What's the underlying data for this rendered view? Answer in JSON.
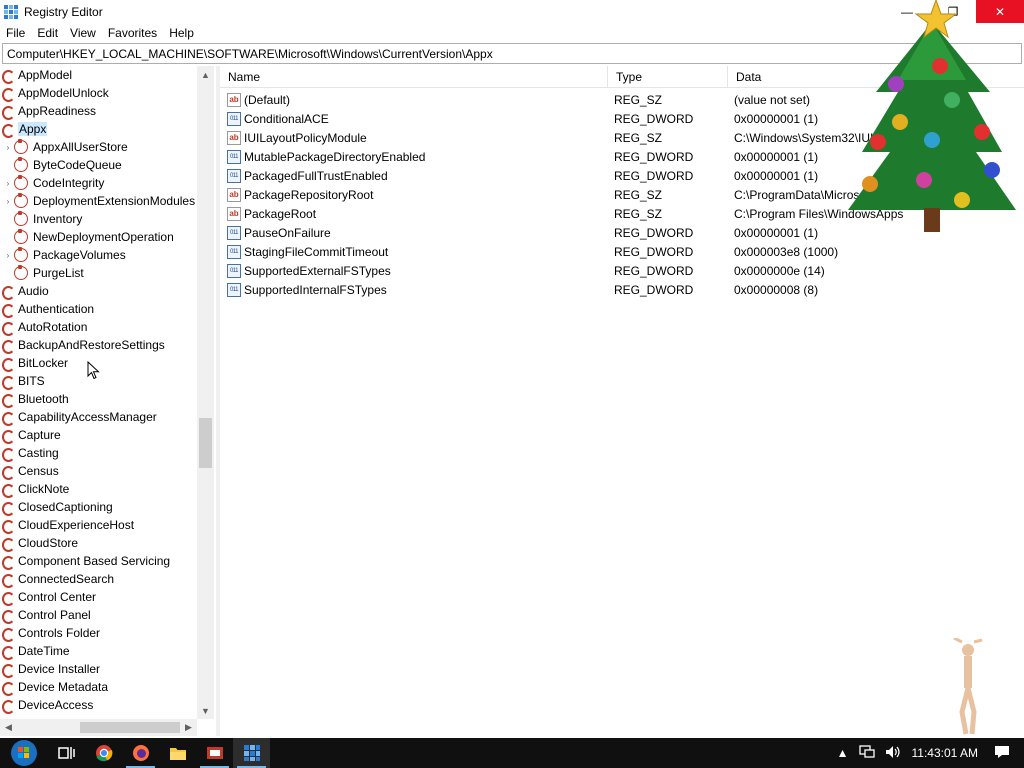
{
  "window": {
    "title": "Registry Editor",
    "controls": {
      "minimize": "—",
      "maximize": "❐",
      "close": "✕"
    }
  },
  "menu": [
    "File",
    "Edit",
    "View",
    "Favorites",
    "Help"
  ],
  "address": "Computer\\HKEY_LOCAL_MACHINE\\SOFTWARE\\Microsoft\\Windows\\CurrentVersion\\Appx",
  "tree": {
    "items": [
      {
        "label": "AppModel",
        "level": 0,
        "expandable": false,
        "selected": false
      },
      {
        "label": "AppModelUnlock",
        "level": 0,
        "expandable": false,
        "selected": false
      },
      {
        "label": "AppReadiness",
        "level": 0,
        "expandable": false,
        "selected": false
      },
      {
        "label": "Appx",
        "level": 0,
        "expandable": false,
        "selected": true
      },
      {
        "label": "AppxAllUserStore",
        "level": 1,
        "expandable": true,
        "selected": false
      },
      {
        "label": "ByteCodeQueue",
        "level": 1,
        "expandable": false,
        "selected": false
      },
      {
        "label": "CodeIntegrity",
        "level": 1,
        "expandable": true,
        "selected": false
      },
      {
        "label": "DeploymentExtensionModules",
        "level": 1,
        "expandable": true,
        "selected": false
      },
      {
        "label": "Inventory",
        "level": 1,
        "expandable": false,
        "selected": false
      },
      {
        "label": "NewDeploymentOperation",
        "level": 1,
        "expandable": false,
        "selected": false
      },
      {
        "label": "PackageVolumes",
        "level": 1,
        "expandable": true,
        "selected": false
      },
      {
        "label": "PurgeList",
        "level": 1,
        "expandable": false,
        "selected": false
      },
      {
        "label": "Audio",
        "level": 0,
        "expandable": false,
        "selected": false
      },
      {
        "label": "Authentication",
        "level": 0,
        "expandable": false,
        "selected": false
      },
      {
        "label": "AutoRotation",
        "level": 0,
        "expandable": false,
        "selected": false
      },
      {
        "label": "BackupAndRestoreSettings",
        "level": 0,
        "expandable": false,
        "selected": false
      },
      {
        "label": "BitLocker",
        "level": 0,
        "expandable": false,
        "selected": false
      },
      {
        "label": "BITS",
        "level": 0,
        "expandable": false,
        "selected": false
      },
      {
        "label": "Bluetooth",
        "level": 0,
        "expandable": false,
        "selected": false
      },
      {
        "label": "CapabilityAccessManager",
        "level": 0,
        "expandable": false,
        "selected": false
      },
      {
        "label": "Capture",
        "level": 0,
        "expandable": false,
        "selected": false
      },
      {
        "label": "Casting",
        "level": 0,
        "expandable": false,
        "selected": false
      },
      {
        "label": "Census",
        "level": 0,
        "expandable": false,
        "selected": false
      },
      {
        "label": "ClickNote",
        "level": 0,
        "expandable": false,
        "selected": false
      },
      {
        "label": "ClosedCaptioning",
        "level": 0,
        "expandable": false,
        "selected": false
      },
      {
        "label": "CloudExperienceHost",
        "level": 0,
        "expandable": false,
        "selected": false
      },
      {
        "label": "CloudStore",
        "level": 0,
        "expandable": false,
        "selected": false
      },
      {
        "label": "Component Based Servicing",
        "level": 0,
        "expandable": false,
        "selected": false
      },
      {
        "label": "ConnectedSearch",
        "level": 0,
        "expandable": false,
        "selected": false
      },
      {
        "label": "Control Center",
        "level": 0,
        "expandable": false,
        "selected": false
      },
      {
        "label": "Control Panel",
        "level": 0,
        "expandable": false,
        "selected": false
      },
      {
        "label": "Controls Folder",
        "level": 0,
        "expandable": false,
        "selected": false
      },
      {
        "label": "DateTime",
        "level": 0,
        "expandable": false,
        "selected": false
      },
      {
        "label": "Device Installer",
        "level": 0,
        "expandable": false,
        "selected": false
      },
      {
        "label": "Device Metadata",
        "level": 0,
        "expandable": false,
        "selected": false
      },
      {
        "label": "DeviceAccess",
        "level": 0,
        "expandable": false,
        "selected": false
      }
    ]
  },
  "list": {
    "columns": {
      "name": "Name",
      "type": "Type",
      "data": "Data"
    },
    "rows": [
      {
        "icon": "string-value-icon",
        "name": "(Default)",
        "type": "REG_SZ",
        "data": "(value not set)"
      },
      {
        "icon": "dword-value-icon",
        "name": "ConditionalACE",
        "type": "REG_DWORD",
        "data": "0x00000001 (1)"
      },
      {
        "icon": "string-value-icon",
        "name": "IUILayoutPolicyModule",
        "type": "REG_SZ",
        "data": "C:\\Windows\\System32\\IUI"
      },
      {
        "icon": "dword-value-icon",
        "name": "MutablePackageDirectoryEnabled",
        "type": "REG_DWORD",
        "data": "0x00000001 (1)"
      },
      {
        "icon": "dword-value-icon",
        "name": "PackagedFullTrustEnabled",
        "type": "REG_DWORD",
        "data": "0x00000001 (1)"
      },
      {
        "icon": "string-value-icon",
        "name": "PackageRepositoryRoot",
        "type": "REG_SZ",
        "data": "C:\\ProgramData\\Microso"
      },
      {
        "icon": "string-value-icon",
        "name": "PackageRoot",
        "type": "REG_SZ",
        "data": "C:\\Program Files\\WindowsApps"
      },
      {
        "icon": "dword-value-icon",
        "name": "PauseOnFailure",
        "type": "REG_DWORD",
        "data": "0x00000001 (1)"
      },
      {
        "icon": "dword-value-icon",
        "name": "StagingFileCommitTimeout",
        "type": "REG_DWORD",
        "data": "0x000003e8 (1000)"
      },
      {
        "icon": "dword-value-icon",
        "name": "SupportedExternalFSTypes",
        "type": "REG_DWORD",
        "data": "0x0000000e (14)"
      },
      {
        "icon": "dword-value-icon",
        "name": "SupportedInternalFSTypes",
        "type": "REG_DWORD",
        "data": "0x00000008 (8)"
      }
    ]
  },
  "icons": {
    "string_value_glyph": "ab",
    "dword_value_glyph": "011\n110"
  },
  "taskbar": {
    "apps": [
      "start-icon",
      "task-view-icon",
      "chrome-icon",
      "firefox-icon",
      "file-explorer-icon",
      "app-icon",
      "registry-editor-icon"
    ],
    "time": "11:43:01 AM"
  },
  "colors": {
    "selection": "#cce8ff",
    "close_button": "#e81123",
    "taskbar": "#101010",
    "registry_icon_red": "#c0392b"
  }
}
